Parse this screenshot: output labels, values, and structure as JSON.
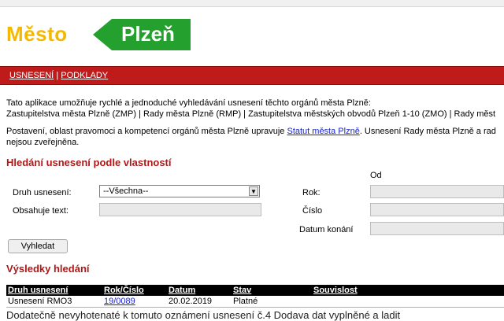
{
  "logo": {
    "word1": "Město",
    "word2": "Plzeň",
    "color_yellow": "#f5b800",
    "color_green": "#23a02d"
  },
  "nav": {
    "item1": "USNESENÍ",
    "separator": "|",
    "item2": "PODKLADY",
    "bg": "#c01b1b"
  },
  "intro": {
    "line1": "Tato aplikace umožňuje rychlé a jednoduché vyhledávání usnesení těchto orgánů města Plzně:",
    "line2": "Zastupitelstva města Plzně (ZMP) | Rady města Plzně (RMP) | Zastupitelstva městských obvodů Plzeň 1-10 (ZMO) | Rady měst",
    "para2_before": "Postavení, oblast pravomoci a kompetencí orgánů města Plzně upravuje ",
    "para2_link": "Statut města Plzně",
    "para2_after": ". Usnesení Rady města Plzně a rad",
    "para2_line2": "nejsou zveřejněna."
  },
  "search": {
    "heading": "Hledání usnesení podle vlastností",
    "od_label": "Od",
    "druh_label": "Druh usnesení:",
    "druh_value": "--Všechna--",
    "obsahuje_label": "Obsahuje text:",
    "rok_label": "Rok:",
    "cislo_label": "Číslo",
    "datum_label": "Datum konání",
    "button": "Vyhledat"
  },
  "results": {
    "heading": "Výsledky hledání",
    "columns": [
      "Druh usnesení",
      "Rok/Číslo",
      "Datum",
      "Stav",
      "Souvislost"
    ],
    "rows": [
      {
        "druh": "Usnesení RMO3",
        "rok_cislo": "19/0089",
        "datum": "20.02.2019",
        "stav": "Platné",
        "souvislost": ""
      }
    ]
  },
  "bottom_cut_text": "Dodatečně nevyhotenaté k tomuto oznámení usnesení č.4 Dodava dat vyplněné a ladit"
}
